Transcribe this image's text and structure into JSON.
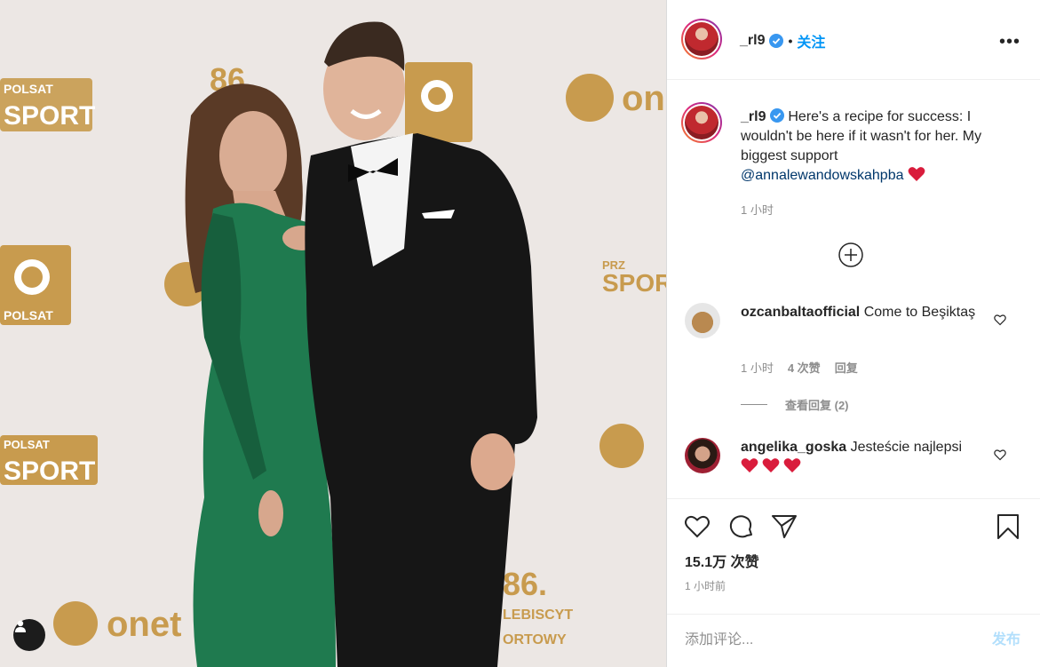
{
  "photo": {
    "backdrop_brands": [
      "POLSAT",
      "SPORT",
      "onet",
      "PRZEGLAD SPORTOWY",
      "86.",
      "PLEBISCYT"
    ],
    "tag_icon": "user-tag-icon",
    "colors": {
      "backdrop": "#ece7e4",
      "gold": "#c89b4e",
      "dress": "#1f7a4f",
      "suit": "#161616"
    }
  },
  "header": {
    "username": "_rl9",
    "verified_icon": "verified-badge-icon",
    "separator": "•",
    "follow_label": "关注",
    "more_icon": "more-options-icon"
  },
  "caption": {
    "username": "_rl9",
    "text": "Here's a recipe for success: I wouldn't be here if it wasn't for her. My biggest support",
    "mention": "@annalewandowskahpba",
    "emoji": "heart-emoji",
    "time": "1 小时"
  },
  "load_more_icon": "plus-circle-icon",
  "comments": [
    {
      "username": "ozcanbaltaofficial",
      "text": "Come to Beşiktaş",
      "time": "1 小时",
      "likes": "4 次赞",
      "reply_label": "回复",
      "view_replies": "查看回复 (2)"
    },
    {
      "username": "angelika_goska",
      "text": "Jesteście najlepsi",
      "emoji": "heart-emoji x3"
    }
  ],
  "actions": {
    "like_icon": "heart-icon",
    "comment_icon": "comment-icon",
    "share_icon": "share-icon",
    "save_icon": "bookmark-icon"
  },
  "likes": "15.1万 次赞",
  "timestamp": "1 小时前",
  "add_comment": {
    "placeholder": "添加评论...",
    "post_label": "发布"
  },
  "colors": {
    "accent": "#0095f6",
    "muted": "#8e8e8e",
    "post_disabled": "#b2dffc",
    "mention": "#00376b",
    "heart": "#e0245e"
  }
}
